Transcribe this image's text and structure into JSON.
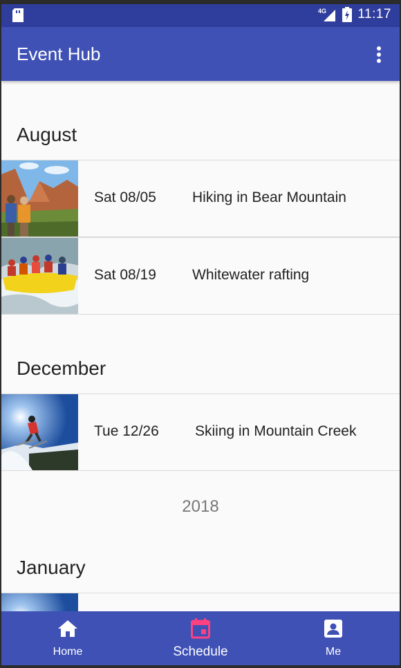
{
  "status_bar": {
    "network": "4G",
    "time": "11:17"
  },
  "app_bar": {
    "title": "Event Hub"
  },
  "sections": [
    {
      "month": "August",
      "events": [
        {
          "date": "Sat 08/05",
          "name": "Hiking in Bear Mountain",
          "image": "hiking-photo"
        },
        {
          "date": "Sat 08/19",
          "name": "Whitewater rafting",
          "image": "rafting-photo"
        }
      ]
    },
    {
      "month": "December",
      "events": [
        {
          "date": "Tue 12/26",
          "name": "Skiing in Mountain Creek",
          "image": "skiing-photo"
        }
      ]
    },
    {
      "year": "2018"
    },
    {
      "month": "January",
      "events": [
        {
          "image": "skiing-photo"
        }
      ]
    }
  ],
  "bottom_nav": {
    "items": [
      {
        "label": "Home",
        "icon": "home-icon"
      },
      {
        "label": "Schedule",
        "icon": "calendar-icon",
        "active": true
      },
      {
        "label": "Me",
        "icon": "profile-icon"
      }
    ]
  },
  "colors": {
    "primary": "#3f51b5",
    "primary_dark": "#2f3d9c",
    "accent": "#ff4081",
    "background": "#fafafa"
  }
}
